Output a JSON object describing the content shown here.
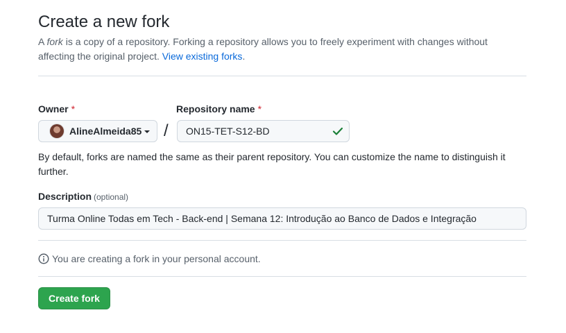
{
  "header": {
    "title": "Create a new fork",
    "intro_prefix": "A ",
    "intro_em": "fork",
    "intro_rest": " is a copy of a repository. Forking a repository allows you to freely experiment with changes without affecting the original project. ",
    "view_forks_link": "View existing forks",
    "intro_suffix": "."
  },
  "form": {
    "owner_label": "Owner",
    "required_mark": "*",
    "owner_value": "AlineAlmeida85",
    "slash": "/",
    "repo_label": "Repository name",
    "repo_value": "ON15-TET-S12-BD",
    "hint": "By default, forks are named the same as their parent repository. You can customize the name to distinguish it further.",
    "description_label": "Description",
    "optional_label": "(optional)",
    "description_value": "Turma Online Todas em Tech - Back-end | Semana 12: Introdução ao Banco de Dados e Integração"
  },
  "notice": {
    "text": "You are creating a fork in your personal account.",
    "icon": "info-icon"
  },
  "actions": {
    "create_label": "Create fork"
  },
  "colors": {
    "primary_button": "#2da44e",
    "link": "#0969da",
    "required": "#cf222e",
    "valid_check": "#1a7f37"
  }
}
